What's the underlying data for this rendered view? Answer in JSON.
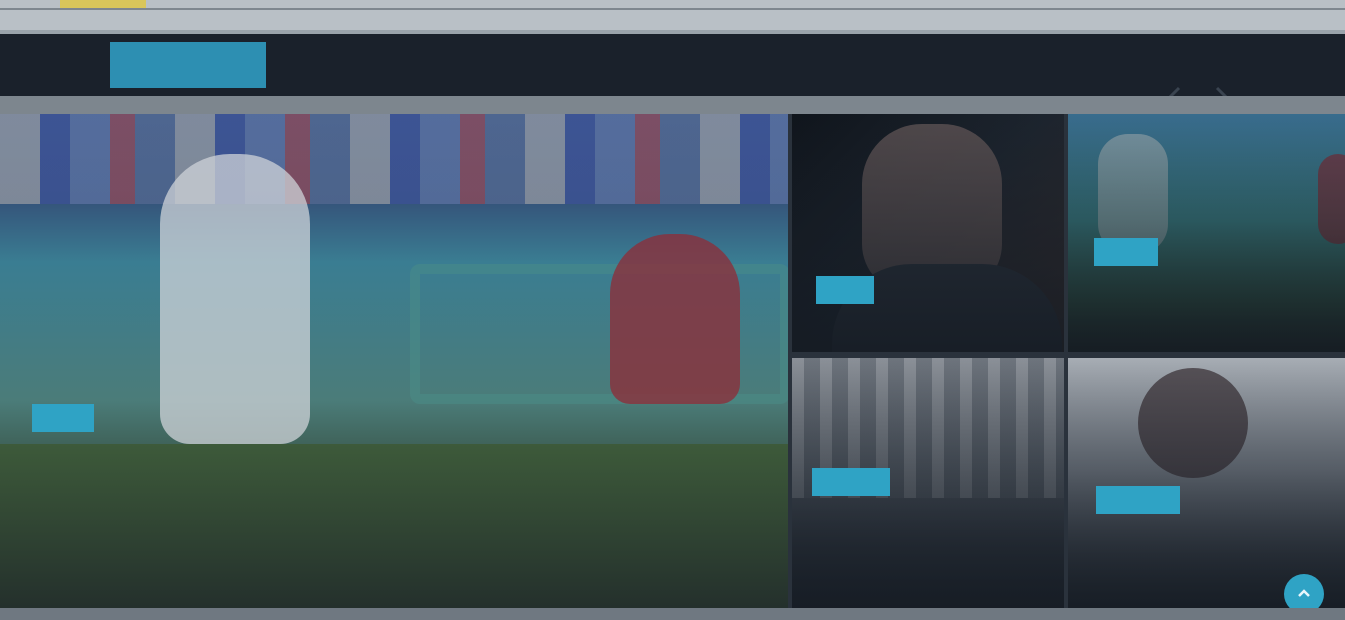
{
  "breaking": {
    "label": "",
    "headline": "",
    "time": "",
    "prev_icon": "chevron-left-icon",
    "next_icon": "chevron-right-icon"
  },
  "main_story": {
    "tag": "",
    "title": "",
    "summary": ""
  },
  "side_stories": [
    {
      "tag": "",
      "title": ""
    },
    {
      "tag": "",
      "title": ""
    },
    {
      "tag": "",
      "title": ""
    },
    {
      "tag": "",
      "title": ""
    }
  ],
  "scroll_top_icon": "arrow-up-icon",
  "colors": {
    "accent": "#2fa3c5",
    "breaking_bar": "#1a212b",
    "time_highlight": "#a7b23c"
  }
}
